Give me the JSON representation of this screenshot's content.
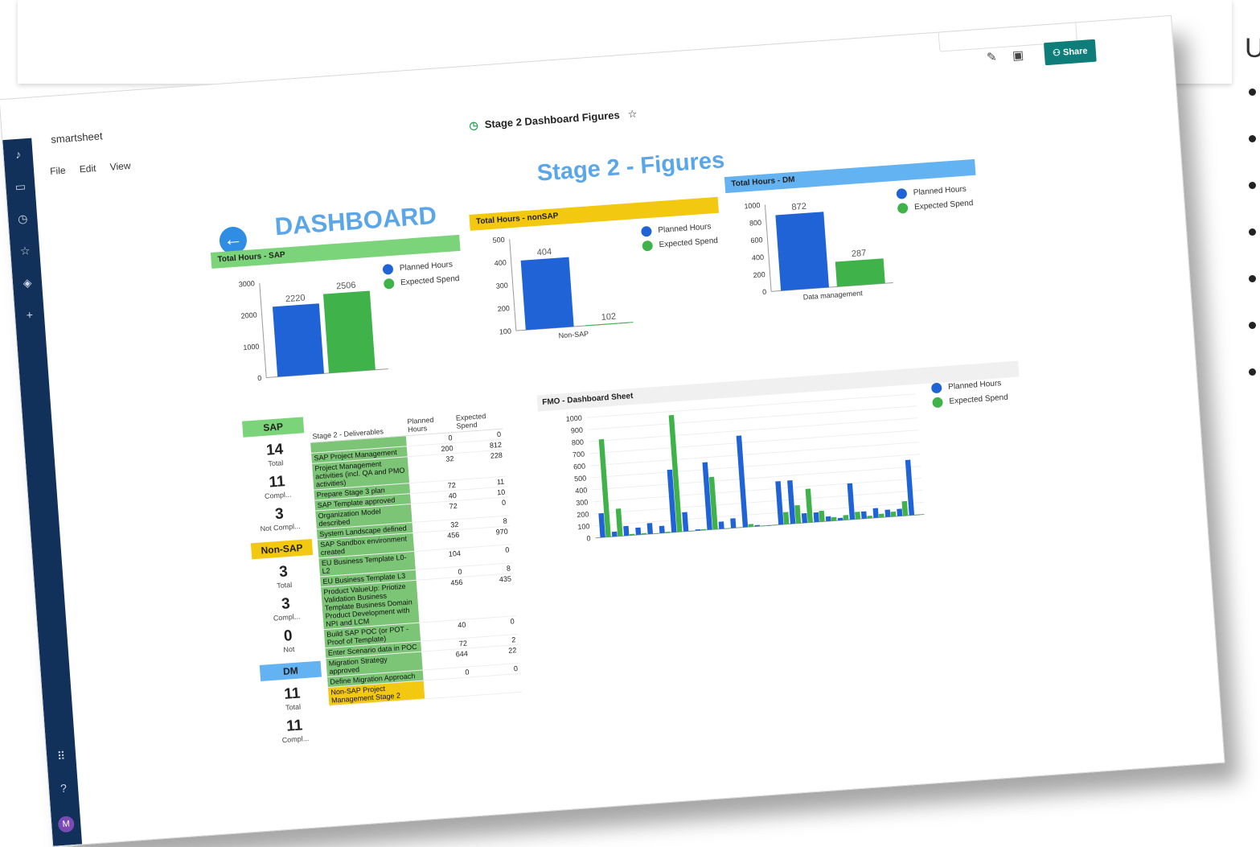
{
  "page": {
    "side_letter": "U",
    "bullet_count": 7
  },
  "app": {
    "brand": "smartsheet",
    "menu": [
      "File",
      "Edit",
      "View"
    ],
    "doc_title": "Stage 2 Dashboard Figures",
    "share_label": "Share"
  },
  "dashboard": {
    "title": "DASHBOARD",
    "stage_title": "Stage 2 - Figures",
    "colors": {
      "planned": "#1f63d6",
      "expected": "#3fb24a",
      "sap": "#7cd47a",
      "nonsap": "#f2c811",
      "dm": "#63b3f2"
    }
  },
  "legend": {
    "planned": "Planned Hours",
    "expected": "Expected Spend"
  },
  "chart_data": [
    {
      "type": "bar",
      "title": "Total Hours - SAP",
      "categories": [
        ""
      ],
      "series": [
        {
          "name": "Planned Hours",
          "values": [
            2220
          ]
        },
        {
          "name": "Expected Spend",
          "values": [
            2506
          ]
        }
      ],
      "yticks": [
        0,
        1000,
        2000,
        3000
      ],
      "ylim": [
        0,
        3000
      ]
    },
    {
      "type": "bar",
      "title": "Total Hours - nonSAP",
      "categories": [
        "Non-SAP"
      ],
      "series": [
        {
          "name": "Planned Hours",
          "values": [
            404
          ]
        },
        {
          "name": "Expected Spend",
          "values": [
            102
          ]
        }
      ],
      "yticks": [
        100,
        200,
        300,
        400,
        500
      ],
      "ylim": [
        100,
        500
      ]
    },
    {
      "type": "bar",
      "title": "Total Hours - DM",
      "categories": [
        "Data management"
      ],
      "series": [
        {
          "name": "Planned Hours",
          "values": [
            872
          ]
        },
        {
          "name": "Expected Spend",
          "values": [
            287
          ]
        }
      ],
      "yticks": [
        0,
        200,
        400,
        600,
        800,
        1000
      ],
      "ylim": [
        0,
        1000
      ]
    },
    {
      "type": "bar",
      "title": "FMO - Dashboard Sheet",
      "yticks": [
        0,
        100,
        200,
        300,
        400,
        500,
        600,
        700,
        800,
        900,
        1000
      ],
      "ylim": [
        0,
        1000
      ],
      "series": [
        {
          "name": "Planned Hours",
          "values": [
            200,
            40,
            80,
            60,
            90,
            60,
            520,
            160,
            10,
            560,
            60,
            80,
            760,
            10,
            0,
            360,
            360,
            80,
            80,
            40,
            20,
            300,
            60,
            80,
            60,
            60,
            460
          ]
        },
        {
          "name": "Expected Spend",
          "values": [
            812,
            228,
            11,
            10,
            0,
            8,
            970,
            0,
            8,
            435,
            0,
            2,
            22,
            0,
            0,
            100,
            150,
            280,
            90,
            30,
            40,
            60,
            20,
            30,
            40,
            120,
            0
          ]
        }
      ]
    }
  ],
  "stats": [
    {
      "label": "SAP",
      "color": "#7cd47a",
      "items": [
        {
          "num": "14",
          "lbl": "Total"
        },
        {
          "num": "11",
          "lbl": "Compl..."
        },
        {
          "num": "3",
          "lbl": "Not Compl..."
        }
      ]
    },
    {
      "label": "Non-SAP",
      "color": "#f2c811",
      "items": [
        {
          "num": "3",
          "lbl": "Total"
        },
        {
          "num": "3",
          "lbl": "Compl..."
        },
        {
          "num": "0",
          "lbl": "Not"
        }
      ]
    },
    {
      "label": "DM",
      "color": "#63b3f2",
      "items": [
        {
          "num": "11",
          "lbl": "Total"
        },
        {
          "num": "11",
          "lbl": "Compl..."
        }
      ]
    }
  ],
  "table": {
    "headers": [
      "Stage 2 - Deliverables",
      "Planned Hours",
      "Expected Spend"
    ],
    "rows": [
      {
        "d": "",
        "p": "0",
        "e": "0"
      },
      {
        "d": "SAP Project Management",
        "p": "200",
        "e": "812"
      },
      {
        "d": "Project Management activities (incl. QA and PMO activities)",
        "p": "32",
        "e": "228"
      },
      {
        "d": "Prepare Stage 3 plan",
        "p": "72",
        "e": "11"
      },
      {
        "d": "SAP Template approved",
        "p": "40",
        "e": "10"
      },
      {
        "d": "Organization Model described",
        "p": "72",
        "e": "0"
      },
      {
        "d": "System Landscape defined",
        "p": "32",
        "e": "8"
      },
      {
        "d": "SAP Sandbox environment created",
        "p": "456",
        "e": "970"
      },
      {
        "d": "EU Business Template L0-L2",
        "p": "104",
        "e": "0"
      },
      {
        "d": "EU Business Template L3",
        "p": "0",
        "e": "8"
      },
      {
        "d": "Product ValueUp: Priotize Validation Business Template Business Domain Product Development with NPI and LCM",
        "p": "456",
        "e": "435"
      },
      {
        "d": "Build SAP POC (or POT - Proof of Template)",
        "p": "40",
        "e": "0"
      },
      {
        "d": "Enter Scenario data in POC",
        "p": "72",
        "e": "2"
      },
      {
        "d": "Migration Strategy approved",
        "p": "644",
        "e": "22"
      },
      {
        "d": "Define Migration Approach",
        "p": "0",
        "e": "0"
      },
      {
        "d": "Non-SAP Project Management Stage 2",
        "p": "",
        "e": "",
        "yellow": true
      }
    ]
  }
}
